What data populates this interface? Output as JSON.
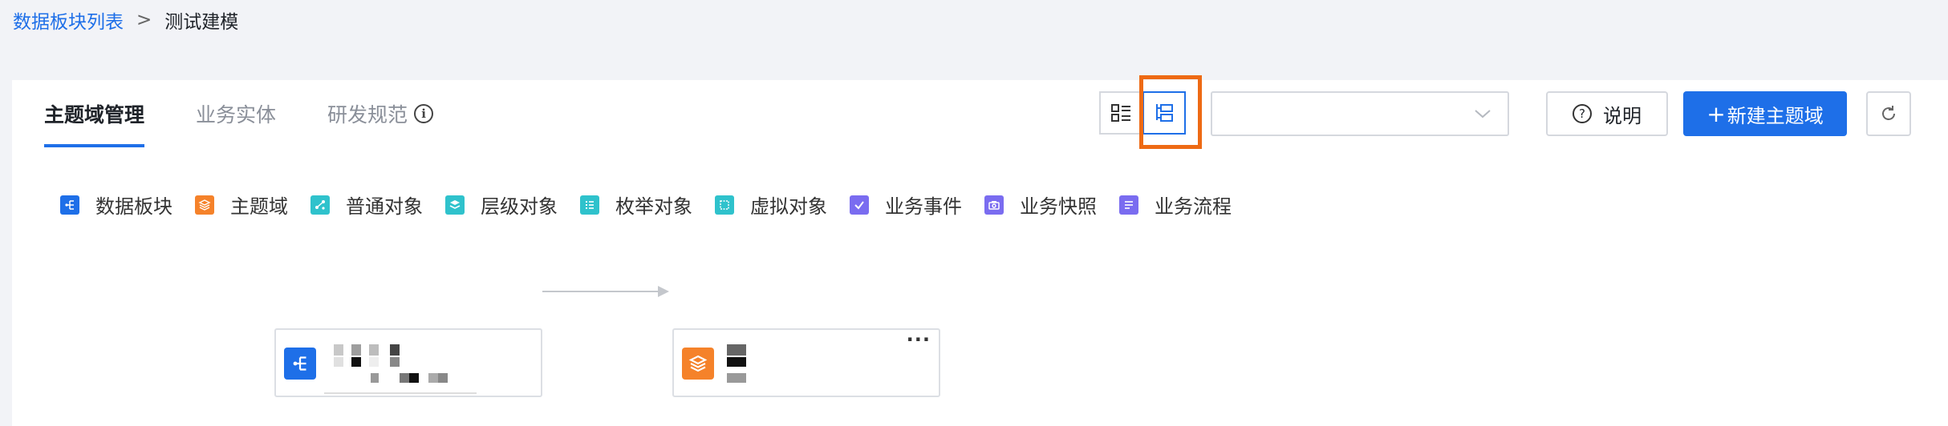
{
  "breadcrumb": {
    "parent": "数据板块列表",
    "separator": ">",
    "current": "测试建模"
  },
  "tabs": [
    {
      "label": "主题域管理",
      "active": true
    },
    {
      "label": "业务实体",
      "active": false
    },
    {
      "label": "研发规范",
      "active": false,
      "has_info_icon": true
    }
  ],
  "toolbar": {
    "view_modes": [
      "list-view-icon",
      "tree-view-icon"
    ],
    "active_view": "tree-view-icon",
    "select": {
      "value": "",
      "icon": "chevron-down-icon"
    },
    "help_label": "说明",
    "new_label": "新建主题域",
    "new_prefix": "+",
    "refresh_icon": "refresh-icon"
  },
  "legend": [
    {
      "label": "数据板块",
      "icon": "data-plate-icon",
      "color": "#1e6fe8"
    },
    {
      "label": "主题域",
      "icon": "subject-domain-icon",
      "color": "#f5822a"
    },
    {
      "label": "普通对象",
      "icon": "normal-object-icon",
      "color": "#2fc2cc"
    },
    {
      "label": "层级对象",
      "icon": "hierarchy-object-icon",
      "color": "#2fc2cc"
    },
    {
      "label": "枚举对象",
      "icon": "enum-object-icon",
      "color": "#2fc2cc"
    },
    {
      "label": "虚拟对象",
      "icon": "virtual-object-icon",
      "color": "#2fc2cc"
    },
    {
      "label": "业务事件",
      "icon": "business-event-icon",
      "color": "#7a6cf0"
    },
    {
      "label": "业务快照",
      "icon": "business-snapshot-icon",
      "color": "#7a6cf0"
    },
    {
      "label": "业务流程",
      "icon": "business-process-icon",
      "color": "#7a6cf0"
    }
  ],
  "graph": {
    "nodes": [
      {
        "type": "数据板块",
        "icon": "data-plate-icon",
        "label_obscured": true
      },
      {
        "type": "主题域",
        "icon": "subject-domain-icon",
        "label_obscured": true,
        "has_more_menu": true
      }
    ],
    "edges": [
      {
        "from": 0,
        "to": 1
      }
    ]
  },
  "colors": {
    "accent": "#1e6fe8",
    "highlight": "#ee6a14",
    "border": "#d5d8de"
  }
}
